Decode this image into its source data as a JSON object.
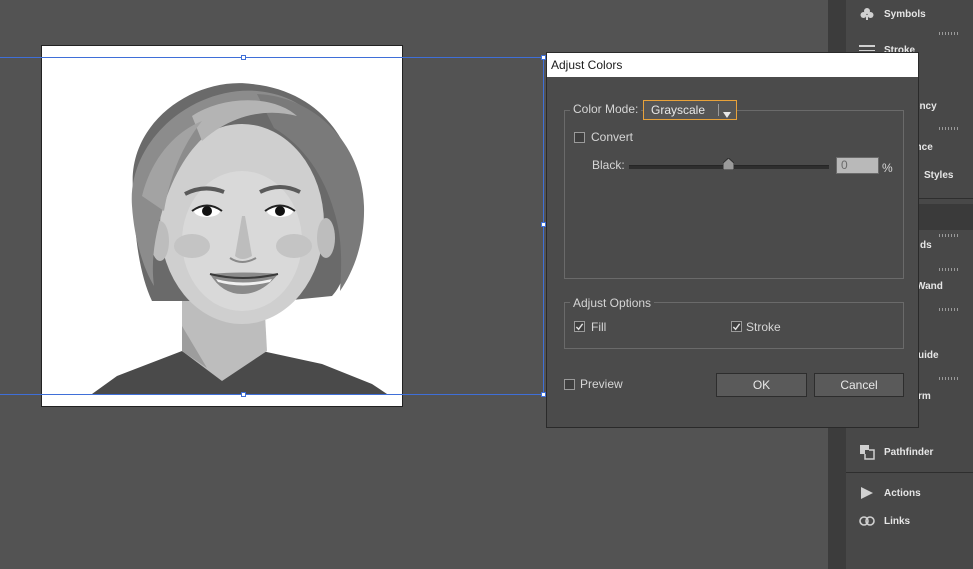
{
  "panels": {
    "items": [
      {
        "label": "Symbols",
        "icon": "club-icon"
      },
      {
        "label": "Stroke",
        "icon": "lines-icon"
      },
      {
        "label": "t",
        "icon": ""
      },
      {
        "label": "rency",
        "icon": ""
      },
      {
        "label": "ance",
        "icon": ""
      },
      {
        "label": "Styles",
        "icon": ""
      },
      {
        "label": "ds",
        "icon": ""
      },
      {
        "label": "Wand",
        "icon": ""
      },
      {
        "label": "uide",
        "icon": ""
      },
      {
        "label": "rm",
        "icon": ""
      },
      {
        "label": "Pathfinder",
        "icon": "pathfinder-icon"
      },
      {
        "label": "Actions",
        "icon": "play-icon"
      },
      {
        "label": "Links",
        "icon": "link-icon"
      }
    ]
  },
  "dialog": {
    "title": "Adjust Colors",
    "color_mode_label": "Color Mode:",
    "color_mode_value": "Grayscale",
    "convert_label": "Convert",
    "convert_checked": false,
    "black_label": "Black:",
    "black_value": "0",
    "black_unit": "%",
    "black_level_percent": 0,
    "adjust_options_label": "Adjust Options",
    "fill_label": "Fill",
    "fill_checked": true,
    "stroke_label": "Stroke",
    "stroke_checked": true,
    "preview_label": "Preview",
    "preview_checked": false,
    "ok_label": "OK",
    "cancel_label": "Cancel"
  },
  "colors": {
    "workspace": "#535353",
    "dialog_bg": "#4b4b4b",
    "focus_orange": "#e8a23a",
    "selection_blue": "#3f6fd8"
  }
}
